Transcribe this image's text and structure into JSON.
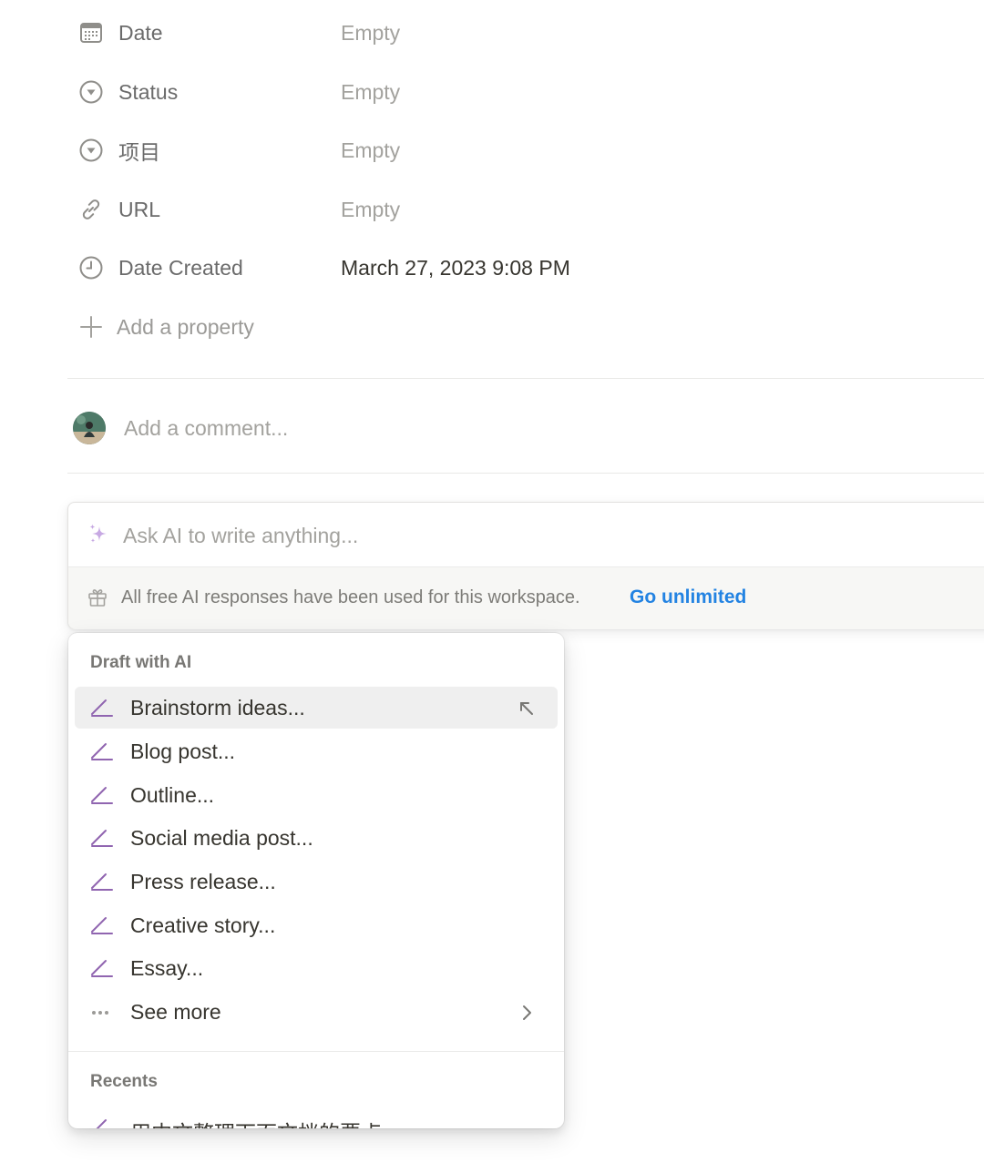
{
  "properties": [
    {
      "icon": "calendar-icon",
      "name": "Date",
      "value": "Empty"
    },
    {
      "icon": "status-icon",
      "name": "Status",
      "value": "Empty"
    },
    {
      "icon": "select-icon",
      "name": "项目",
      "value": "Empty"
    },
    {
      "icon": "link-icon",
      "name": "URL",
      "value": "Empty"
    },
    {
      "icon": "clock-icon",
      "name": "Date Created",
      "value": "March 27, 2023 9:08 PM"
    }
  ],
  "add_property_label": "Add a property",
  "comment": {
    "placeholder": "Add a comment..."
  },
  "ai": {
    "input_placeholder": "Ask AI to write anything...",
    "notice": "All free AI responses have been used for this workspace.",
    "notice_link": "Go unlimited",
    "accent_color": "#2383e2",
    "icon_color": "#9065b0"
  },
  "menu": {
    "section_draft": "Draft with AI",
    "items": [
      {
        "icon": "pencil-icon",
        "label": "Brainstorm ideas..."
      },
      {
        "icon": "pencil-icon",
        "label": "Blog post..."
      },
      {
        "icon": "pencil-icon",
        "label": "Outline..."
      },
      {
        "icon": "pencil-icon",
        "label": "Social media post..."
      },
      {
        "icon": "pencil-icon",
        "label": "Press release..."
      },
      {
        "icon": "pencil-icon",
        "label": "Creative story..."
      },
      {
        "icon": "pencil-icon",
        "label": "Essay..."
      },
      {
        "icon": "more-icon",
        "label": "See more"
      }
    ],
    "section_recents": "Recents",
    "recent_items": [
      {
        "icon": "pencil-icon",
        "label": "用中文整理下面文档的要点"
      }
    ]
  }
}
